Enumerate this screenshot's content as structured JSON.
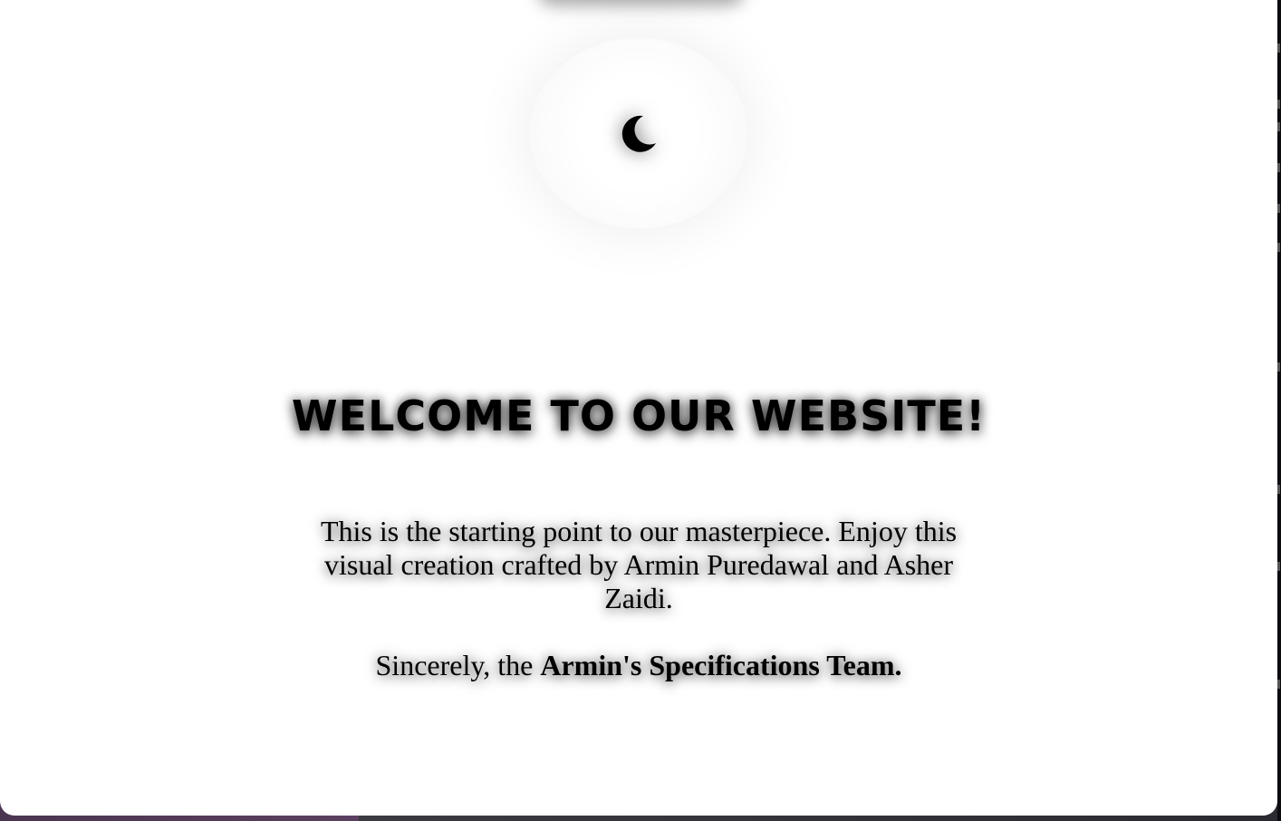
{
  "page": {
    "headline": "WELCOME TO OUR WEBSITE!",
    "intro": "This is the starting point to our masterpiece. Enjoy this visual creation crafted by Armin Puredawal and Asher Zaidi.",
    "signoff_prefix": "Sincerely, the ",
    "signoff_team": "Armin's Specifications Team."
  },
  "theme_toggle": {
    "icon": "moon-icon",
    "mode": "dark-mode"
  },
  "colors": {
    "background": "#ffffff",
    "text": "#000000",
    "desktop_left": "#5b4060",
    "desktop_right": "#2a2a30"
  }
}
